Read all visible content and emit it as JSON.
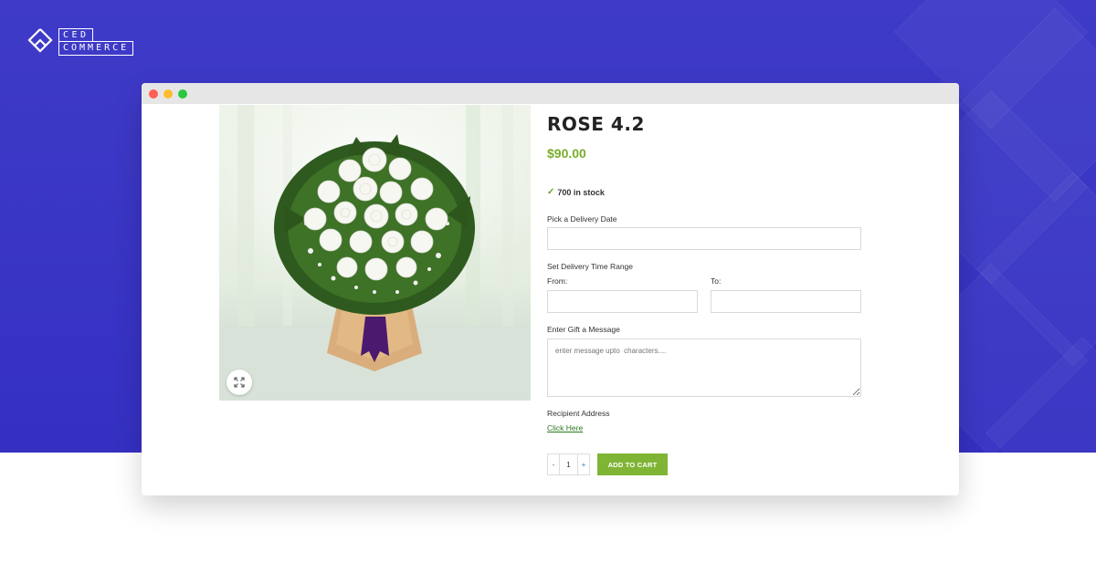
{
  "brand": {
    "line1": "CED",
    "line2": "COMMERCE",
    "background_color": "#3b37c6"
  },
  "browser": {
    "dots": [
      "red",
      "yellow",
      "green"
    ]
  },
  "product": {
    "title": "ROSE 4.2",
    "price": "$90.00",
    "stock": "700 in stock",
    "image_description_icon": "white-rose-bouquet",
    "zoom_icon": "expand-icon"
  },
  "form": {
    "delivery_date_label": "Pick a Delivery Date",
    "delivery_date_value": "",
    "time_range_label": "Set Delivery Time Range",
    "from_label": "From:",
    "to_label": "To:",
    "from_value": "",
    "to_value": "",
    "gift_message_label": "Enter Gift a Message",
    "gift_message_placeholder": "enter message upto  characters....",
    "recipient_label": "Recipient Address",
    "recipient_link": "Click Here"
  },
  "cart": {
    "minus": "-",
    "quantity": "1",
    "plus": "+",
    "add_label": "ADD TO CART",
    "accent_color": "#80b435"
  }
}
